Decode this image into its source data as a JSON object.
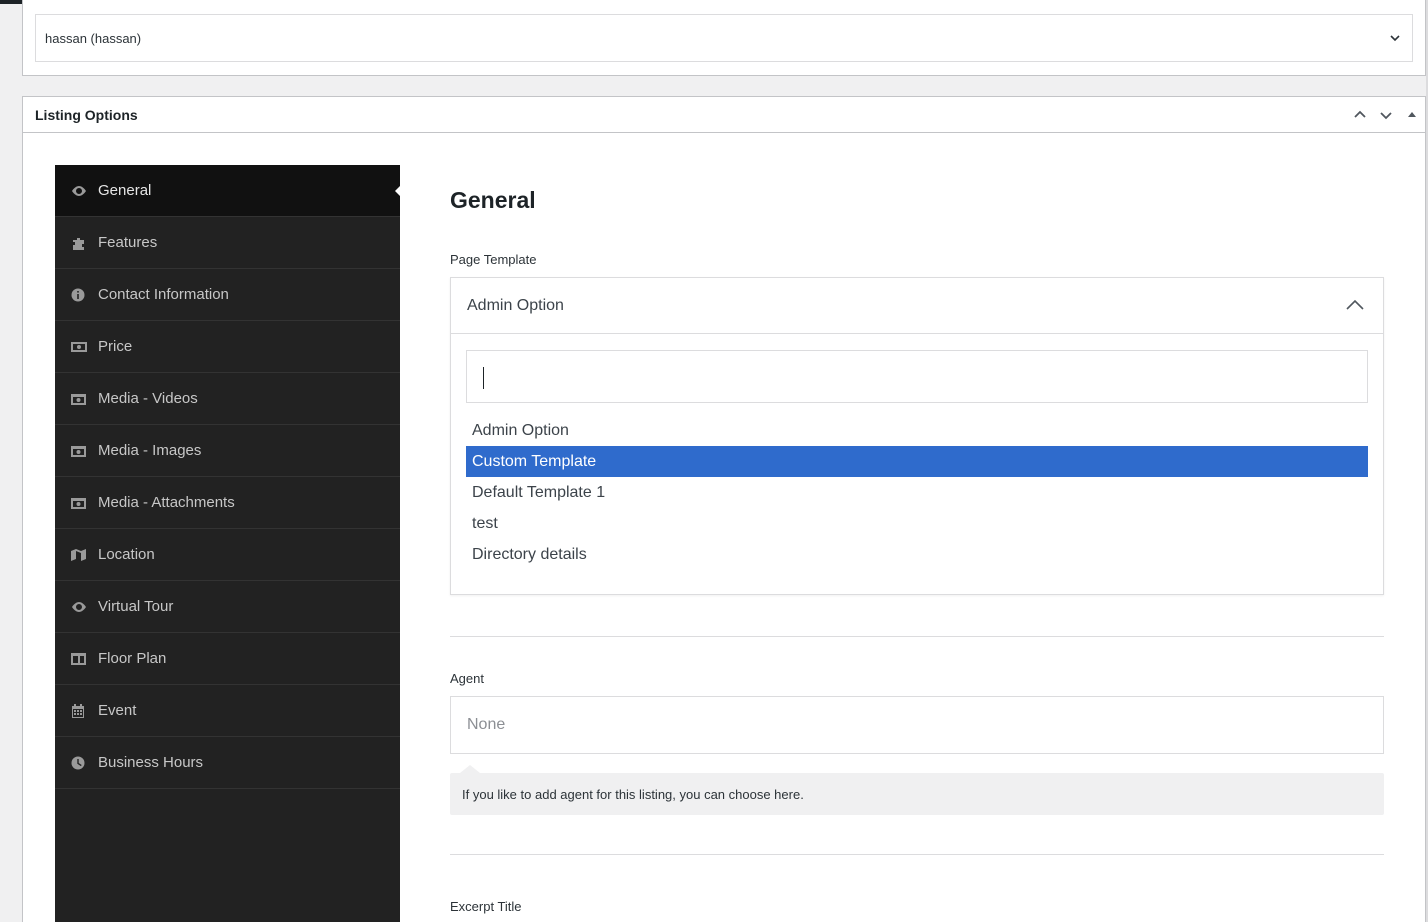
{
  "author": {
    "selected": "hassan (hassan)"
  },
  "postbox": {
    "title": "Listing Options"
  },
  "sidebar": {
    "items": [
      {
        "label": "General",
        "icon": "eye-icon"
      },
      {
        "label": "Features",
        "icon": "puzzle-icon"
      },
      {
        "label": "Contact Information",
        "icon": "info-icon"
      },
      {
        "label": "Price",
        "icon": "money-icon"
      },
      {
        "label": "Media - Videos",
        "icon": "camera-icon"
      },
      {
        "label": "Media - Images",
        "icon": "camera-icon"
      },
      {
        "label": "Media - Attachments",
        "icon": "camera-icon"
      },
      {
        "label": "Location",
        "icon": "map-icon"
      },
      {
        "label": "Virtual Tour",
        "icon": "eye-icon"
      },
      {
        "label": "Floor Plan",
        "icon": "columns-icon"
      },
      {
        "label": "Event",
        "icon": "calendar-icon"
      },
      {
        "label": "Business Hours",
        "icon": "clock-icon"
      }
    ],
    "active_index": 0
  },
  "content": {
    "section_title": "General",
    "page_template": {
      "label": "Page Template",
      "selected": "Admin Option",
      "search_value": "",
      "options": [
        "Admin Option",
        "Custom Template",
        "Default Template 1",
        "test",
        "Directory details"
      ],
      "highlighted_index": 1
    },
    "agent": {
      "label": "Agent",
      "placeholder": "None",
      "hint": "If you like to add agent for this listing, you can choose here."
    },
    "excerpt": {
      "label": "Excerpt Title"
    }
  },
  "colors": {
    "sidebar_bg": "#222222",
    "sidebar_active_bg": "#111111",
    "highlight": "#2f6bcc"
  }
}
